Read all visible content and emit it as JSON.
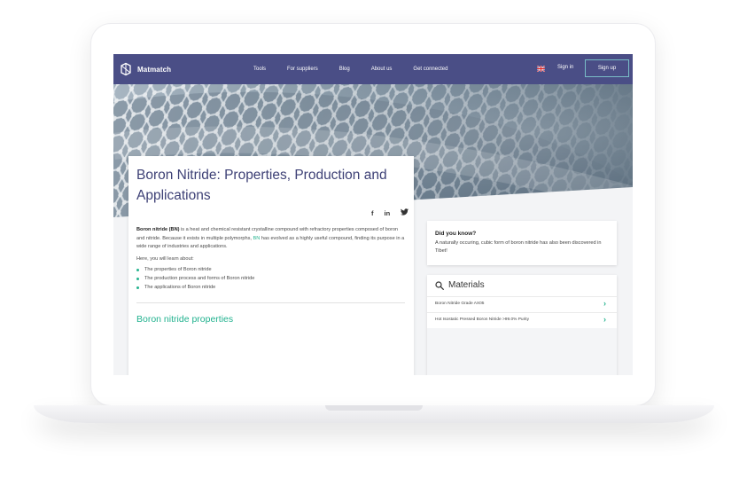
{
  "navbar": {
    "brand": "Matmatch",
    "links": [
      "Tools",
      "For suppliers",
      "Blog",
      "About us",
      "Get connected"
    ],
    "sign_in": "Sign in",
    "sign_up": "Sign up"
  },
  "article": {
    "title": "Boron Nitride: Properties, Production and Applications",
    "share_icons": [
      "facebook-icon",
      "linkedin-icon",
      "twitter-icon"
    ],
    "intro_bold": "Boron nitride (BN)",
    "intro_part1": " is a heat and chemical resistant crystalline compound with refractory properties composed of boron and nitride. Because it exists in multiple polymorphs, ",
    "intro_link": "BN",
    "intro_part2": " has evolved as a highly useful compound, finding its purpose in a wide range of industries and applications.",
    "learn_text": "Here, you will learn about:",
    "bullets": [
      "The properties of Boron nitride",
      "The production process and forms of Boron nitride",
      "The applications of Boron nitride"
    ],
    "section_title": "Boron nitride properties"
  },
  "did_you_know": {
    "title": "Did you know?",
    "text": "A naturally occuring, cubic form of boron nitride has also been discovered in Tibet!"
  },
  "materials": {
    "title": "Materials",
    "items": [
      "Boron Nitride Grade AX05",
      "Hot Isostatic Pressed Boron Nitride >99.0% Purity"
    ]
  },
  "colors": {
    "navbar": "#4a4e86",
    "accent": "#27b38f",
    "title": "#3e4176"
  }
}
